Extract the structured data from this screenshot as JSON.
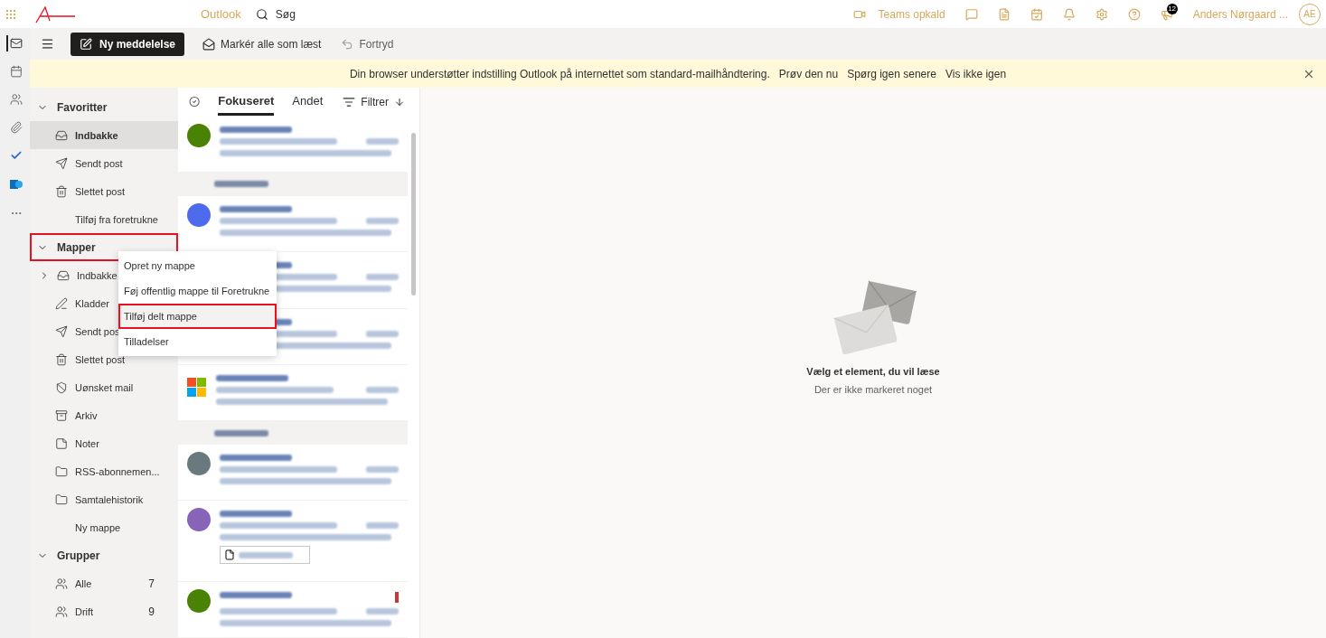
{
  "topbar": {
    "app_name": "Outlook",
    "search_placeholder": "Søg",
    "teams_label": "Teams opkald",
    "notification_count": "12",
    "user_name": "Anders Nørgaard ...",
    "user_initials": "AE"
  },
  "rail": [
    {
      "kind": "mail",
      "selected": true
    },
    {
      "kind": "calendar",
      "selected": false
    },
    {
      "kind": "people",
      "selected": false
    },
    {
      "kind": "attach",
      "selected": false
    },
    {
      "kind": "todo",
      "selected": false
    },
    {
      "kind": "app",
      "selected": false
    },
    {
      "kind": "more",
      "selected": false
    }
  ],
  "toolbar": {
    "new_message": "Ny meddelelse",
    "mark_all_read": "Markér alle som læst",
    "undo": "Fortryd"
  },
  "banner": {
    "message": "Din browser understøtter indstilling Outlook på internettet som standard-mailhåndtering.",
    "links": [
      "Prøv den nu",
      "Spørg igen senere",
      "Vis ikke igen"
    ]
  },
  "folder_sections": [
    {
      "title": "Favoritter",
      "expanded": true,
      "highlighted": false,
      "items": [
        {
          "label": "Indbakke",
          "kind": "inbox",
          "selected": true
        },
        {
          "label": "Sendt post",
          "kind": "send",
          "selected": false
        },
        {
          "label": "Slettet post",
          "kind": "trash",
          "selected": false
        },
        {
          "label": "Tilføj fra foretrukne",
          "kind": "plain",
          "selected": false
        }
      ]
    },
    {
      "title": "Mapper",
      "expanded": true,
      "highlighted": true,
      "items": [
        {
          "label": "Indbakke",
          "kind": "inbox",
          "selected": false,
          "has_children": true
        },
        {
          "label": "Kladder",
          "kind": "draft",
          "selected": false
        },
        {
          "label": "Sendt pos",
          "kind": "send",
          "selected": false
        },
        {
          "label": "Slettet post",
          "kind": "trash",
          "selected": false
        },
        {
          "label": "Uønsket mail",
          "kind": "junk",
          "selected": false
        },
        {
          "label": "Arkiv",
          "kind": "archive",
          "selected": false
        },
        {
          "label": "Noter",
          "kind": "note",
          "selected": false
        },
        {
          "label": "RSS-abonnemen...",
          "kind": "folder",
          "selected": false
        },
        {
          "label": "Samtalehistorik",
          "kind": "folder",
          "selected": false
        },
        {
          "label": "Ny mappe",
          "kind": "plain",
          "selected": false
        }
      ]
    },
    {
      "title": "Grupper",
      "expanded": true,
      "highlighted": false,
      "items": [
        {
          "label": "Alle",
          "kind": "group",
          "selected": false,
          "count": "7"
        },
        {
          "label": "Drift",
          "kind": "group",
          "selected": false,
          "count": "9"
        }
      ]
    }
  ],
  "context_menu": [
    {
      "label": "Opret ny mappe",
      "highlighted": false
    },
    {
      "label": "Føj offentlig mappe til Foretrukne",
      "highlighted": false
    },
    {
      "label": "Tilføj delt mappe",
      "highlighted": true
    },
    {
      "label": "Tilladelser",
      "highlighted": false
    }
  ],
  "message_tabs": [
    {
      "label": "Fokuseret",
      "selected": true
    },
    {
      "label": "Andet",
      "selected": false
    }
  ],
  "filter_label": "Filtrer",
  "messages": [
    {
      "kind": "avatar",
      "color": "#498205",
      "flagged": false,
      "attachment": false
    },
    {
      "kind": "header"
    },
    {
      "kind": "avatar",
      "color": "#4f6bed",
      "flagged": false,
      "attachment": false
    },
    {
      "kind": "plain",
      "flagged": false,
      "attachment": false
    },
    {
      "kind": "plain",
      "flagged": false,
      "attachment": false
    },
    {
      "kind": "logo",
      "flagged": false,
      "attachment": false
    },
    {
      "kind": "header"
    },
    {
      "kind": "avatar",
      "color": "#69797e",
      "flagged": false,
      "attachment": false
    },
    {
      "kind": "avatar",
      "color": "#8764b8",
      "flagged": false,
      "attachment": true
    },
    {
      "kind": "avatar",
      "color": "#498205",
      "flagged": true,
      "attachment": false
    }
  ],
  "reading_pane": {
    "title": "Vælg et element, du vil læse",
    "subtitle": "Der er ikke markeret noget"
  }
}
